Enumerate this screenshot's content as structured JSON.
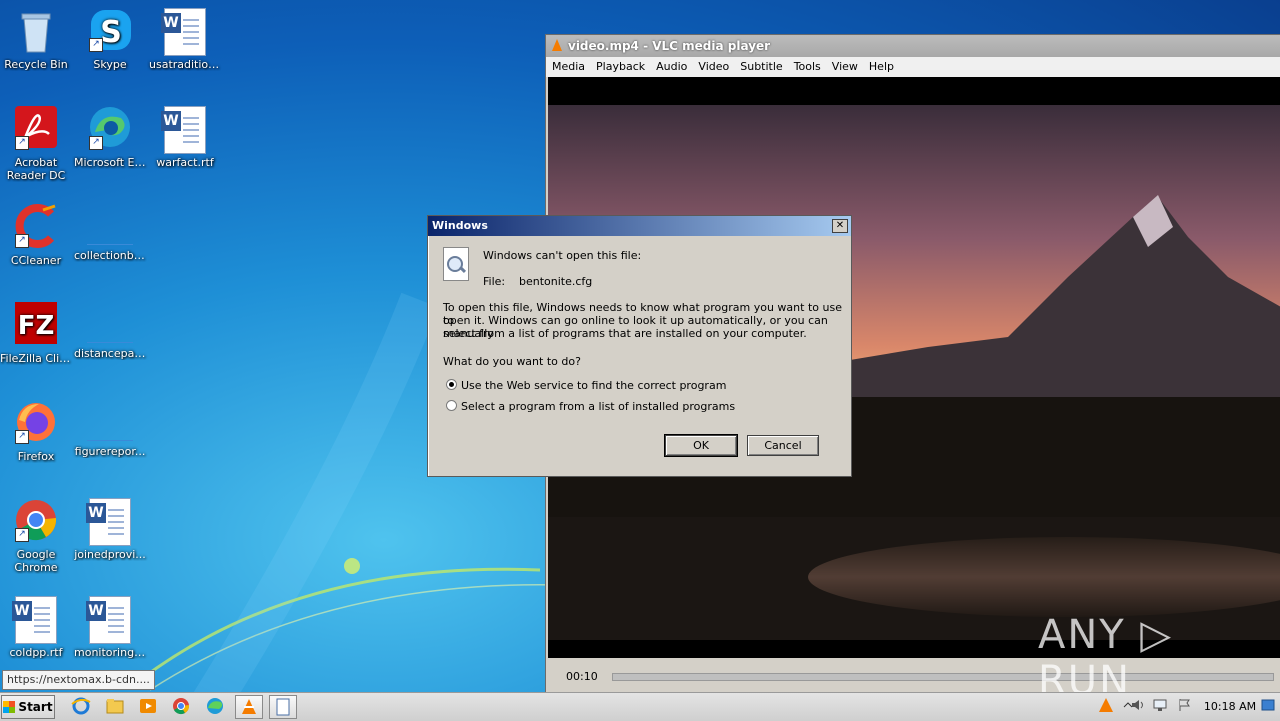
{
  "desktop": {
    "icons": [
      {
        "label": "Recycle Bin"
      },
      {
        "label": "Skype"
      },
      {
        "label": "usatradition..."
      },
      {
        "label": "Acrobat Reader DC"
      },
      {
        "label": "Microsoft Edge"
      },
      {
        "label": "warfact.rtf"
      },
      {
        "label": "CCleaner"
      },
      {
        "label": "collectionbe..."
      },
      {
        "label": "FileZilla Client"
      },
      {
        "label": "distancepas..."
      },
      {
        "label": "Firefox"
      },
      {
        "label": "figurerepor..."
      },
      {
        "label": "Google Chrome"
      },
      {
        "label": "joinedprovi..."
      },
      {
        "label": "coldpp.rtf"
      },
      {
        "label": "monitoringpl..."
      }
    ]
  },
  "vlc": {
    "title": "video.mp4 - VLC media player",
    "menu": [
      "Media",
      "Playback",
      "Audio",
      "Video",
      "Subtitle",
      "Tools",
      "View",
      "Help"
    ],
    "time": "00:10"
  },
  "dialog": {
    "title": "Windows",
    "close": "✕",
    "heading": "Windows can't open this file:",
    "file_label": "File:",
    "file_name": "bentonite.cfg",
    "description_line1": "To open this file, Windows needs to know what program you want to use to",
    "description_line2": "open it. Windows can go online to look it up automatically, or you can manually",
    "description_line3": "select from a list of programs that are installed on your computer.",
    "question": "What do you want to do?",
    "option_web": "Use the Web service to find the correct program",
    "option_list": "Select a program from a list of installed programs",
    "selected_option": "web",
    "ok": "OK",
    "cancel": "Cancel"
  },
  "status_tip": "https://nextomax.b-cdn....",
  "taskbar": {
    "start": "Start",
    "clock": "10:18 AM"
  },
  "watermark": "ANY ▷ RUN"
}
